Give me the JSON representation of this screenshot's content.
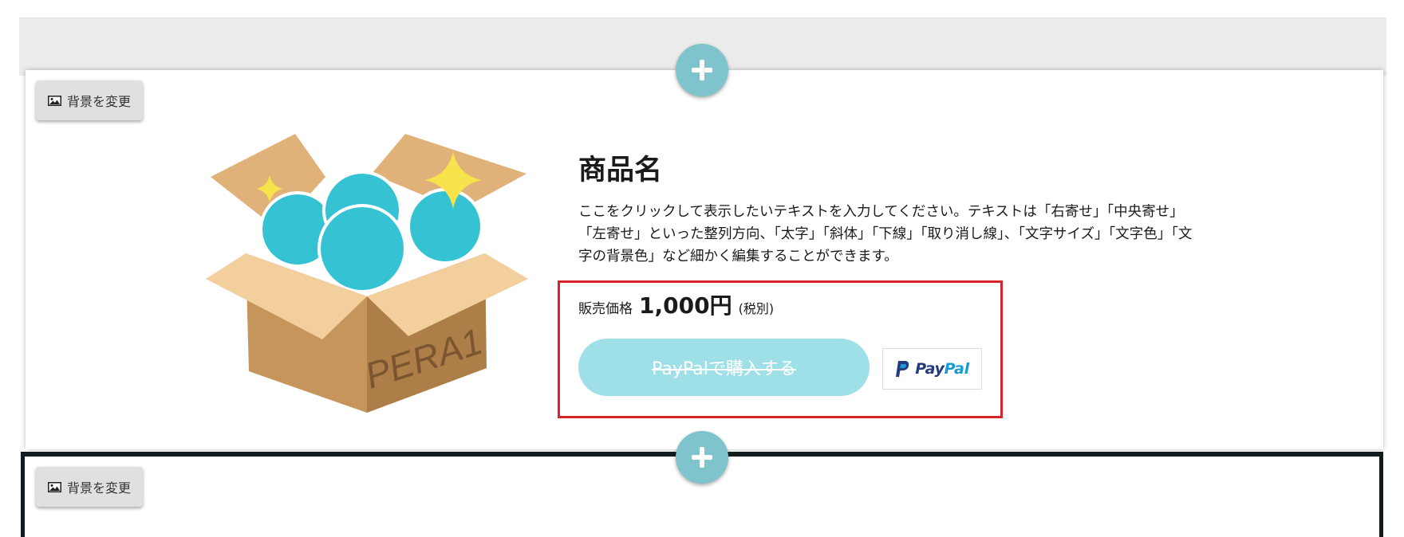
{
  "editor": {
    "change_background_label": "背景を変更",
    "add_block_title": "+"
  },
  "product": {
    "name": "商品名",
    "description": "ここをクリックして表示したいテキストを入力してください。テキストは「右寄せ」「中央寄せ」「左寄せ」といった整列方向、「太字」「斜体」「下線」「取り消し線」、「文字サイズ」「文字色」「文字の背景色」など細かく編集することができます。",
    "price_label": "販売価格",
    "price_value": "1,000円",
    "price_tax": "(税別)",
    "buy_button_label": "PayPalで購入する",
    "paypal_logo_text_a": "Pay",
    "paypal_logo_text_b": "Pal",
    "box_label": "PERA1"
  },
  "colors": {
    "add_button": "#7fc3cd",
    "buy_button": "#9fe0e8",
    "highlight_border": "#d5252b",
    "paypal_dark": "#253b80",
    "paypal_light": "#179bd7",
    "box_body": "#c6955c",
    "ball": "#35c3d3"
  },
  "icons": [
    "image-icon",
    "plus-icon",
    "paypal-p-icon"
  ]
}
